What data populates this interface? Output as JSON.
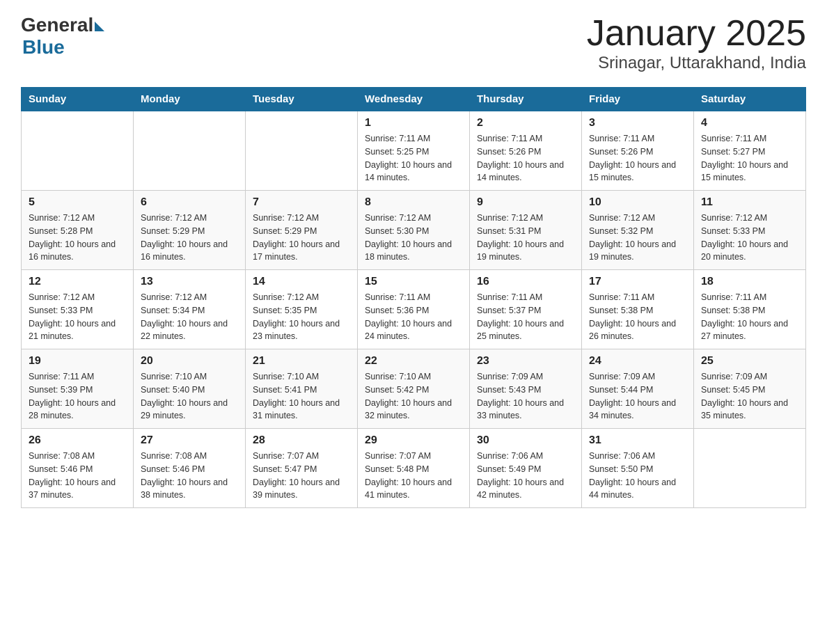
{
  "header": {
    "logo_general": "General",
    "logo_blue": "Blue",
    "title": "January 2025",
    "subtitle": "Srinagar, Uttarakhand, India"
  },
  "weekdays": [
    "Sunday",
    "Monday",
    "Tuesday",
    "Wednesday",
    "Thursday",
    "Friday",
    "Saturday"
  ],
  "weeks": [
    [
      {
        "day": "",
        "info": ""
      },
      {
        "day": "",
        "info": ""
      },
      {
        "day": "",
        "info": ""
      },
      {
        "day": "1",
        "info": "Sunrise: 7:11 AM\nSunset: 5:25 PM\nDaylight: 10 hours\nand 14 minutes."
      },
      {
        "day": "2",
        "info": "Sunrise: 7:11 AM\nSunset: 5:26 PM\nDaylight: 10 hours\nand 14 minutes."
      },
      {
        "day": "3",
        "info": "Sunrise: 7:11 AM\nSunset: 5:26 PM\nDaylight: 10 hours\nand 15 minutes."
      },
      {
        "day": "4",
        "info": "Sunrise: 7:11 AM\nSunset: 5:27 PM\nDaylight: 10 hours\nand 15 minutes."
      }
    ],
    [
      {
        "day": "5",
        "info": "Sunrise: 7:12 AM\nSunset: 5:28 PM\nDaylight: 10 hours\nand 16 minutes."
      },
      {
        "day": "6",
        "info": "Sunrise: 7:12 AM\nSunset: 5:29 PM\nDaylight: 10 hours\nand 16 minutes."
      },
      {
        "day": "7",
        "info": "Sunrise: 7:12 AM\nSunset: 5:29 PM\nDaylight: 10 hours\nand 17 minutes."
      },
      {
        "day": "8",
        "info": "Sunrise: 7:12 AM\nSunset: 5:30 PM\nDaylight: 10 hours\nand 18 minutes."
      },
      {
        "day": "9",
        "info": "Sunrise: 7:12 AM\nSunset: 5:31 PM\nDaylight: 10 hours\nand 19 minutes."
      },
      {
        "day": "10",
        "info": "Sunrise: 7:12 AM\nSunset: 5:32 PM\nDaylight: 10 hours\nand 19 minutes."
      },
      {
        "day": "11",
        "info": "Sunrise: 7:12 AM\nSunset: 5:33 PM\nDaylight: 10 hours\nand 20 minutes."
      }
    ],
    [
      {
        "day": "12",
        "info": "Sunrise: 7:12 AM\nSunset: 5:33 PM\nDaylight: 10 hours\nand 21 minutes."
      },
      {
        "day": "13",
        "info": "Sunrise: 7:12 AM\nSunset: 5:34 PM\nDaylight: 10 hours\nand 22 minutes."
      },
      {
        "day": "14",
        "info": "Sunrise: 7:12 AM\nSunset: 5:35 PM\nDaylight: 10 hours\nand 23 minutes."
      },
      {
        "day": "15",
        "info": "Sunrise: 7:11 AM\nSunset: 5:36 PM\nDaylight: 10 hours\nand 24 minutes."
      },
      {
        "day": "16",
        "info": "Sunrise: 7:11 AM\nSunset: 5:37 PM\nDaylight: 10 hours\nand 25 minutes."
      },
      {
        "day": "17",
        "info": "Sunrise: 7:11 AM\nSunset: 5:38 PM\nDaylight: 10 hours\nand 26 minutes."
      },
      {
        "day": "18",
        "info": "Sunrise: 7:11 AM\nSunset: 5:38 PM\nDaylight: 10 hours\nand 27 minutes."
      }
    ],
    [
      {
        "day": "19",
        "info": "Sunrise: 7:11 AM\nSunset: 5:39 PM\nDaylight: 10 hours\nand 28 minutes."
      },
      {
        "day": "20",
        "info": "Sunrise: 7:10 AM\nSunset: 5:40 PM\nDaylight: 10 hours\nand 29 minutes."
      },
      {
        "day": "21",
        "info": "Sunrise: 7:10 AM\nSunset: 5:41 PM\nDaylight: 10 hours\nand 31 minutes."
      },
      {
        "day": "22",
        "info": "Sunrise: 7:10 AM\nSunset: 5:42 PM\nDaylight: 10 hours\nand 32 minutes."
      },
      {
        "day": "23",
        "info": "Sunrise: 7:09 AM\nSunset: 5:43 PM\nDaylight: 10 hours\nand 33 minutes."
      },
      {
        "day": "24",
        "info": "Sunrise: 7:09 AM\nSunset: 5:44 PM\nDaylight: 10 hours\nand 34 minutes."
      },
      {
        "day": "25",
        "info": "Sunrise: 7:09 AM\nSunset: 5:45 PM\nDaylight: 10 hours\nand 35 minutes."
      }
    ],
    [
      {
        "day": "26",
        "info": "Sunrise: 7:08 AM\nSunset: 5:46 PM\nDaylight: 10 hours\nand 37 minutes."
      },
      {
        "day": "27",
        "info": "Sunrise: 7:08 AM\nSunset: 5:46 PM\nDaylight: 10 hours\nand 38 minutes."
      },
      {
        "day": "28",
        "info": "Sunrise: 7:07 AM\nSunset: 5:47 PM\nDaylight: 10 hours\nand 39 minutes."
      },
      {
        "day": "29",
        "info": "Sunrise: 7:07 AM\nSunset: 5:48 PM\nDaylight: 10 hours\nand 41 minutes."
      },
      {
        "day": "30",
        "info": "Sunrise: 7:06 AM\nSunset: 5:49 PM\nDaylight: 10 hours\nand 42 minutes."
      },
      {
        "day": "31",
        "info": "Sunrise: 7:06 AM\nSunset: 5:50 PM\nDaylight: 10 hours\nand 44 minutes."
      },
      {
        "day": "",
        "info": ""
      }
    ]
  ]
}
